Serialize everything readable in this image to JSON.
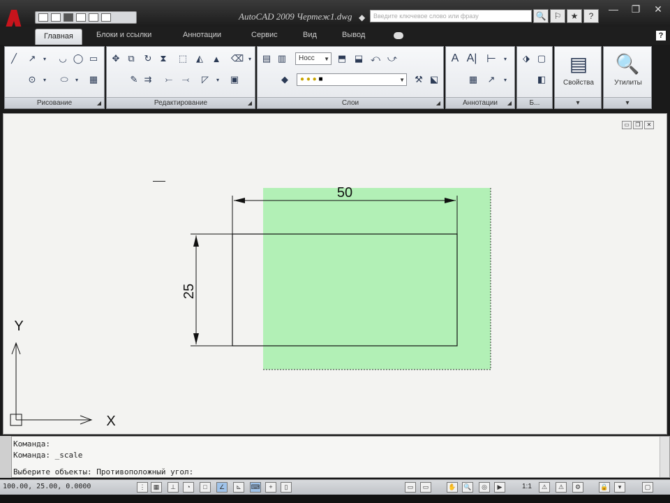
{
  "window": {
    "title": "AutoCAD 2009 Чертеж1.dwg",
    "search_placeholder": "Введите ключевое слово или фразу",
    "controls": [
      "—",
      "❐",
      "✕"
    ],
    "help_label": "?"
  },
  "ribbon_tabs": [
    {
      "label": "Главная",
      "active": true
    },
    {
      "label": "Блоки и ссылки",
      "active": false
    },
    {
      "label": "Аннотации",
      "active": false
    },
    {
      "label": "Сервис",
      "active": false
    },
    {
      "label": "Вид",
      "active": false
    },
    {
      "label": "Вывод",
      "active": false
    }
  ],
  "panels": {
    "draw": {
      "title": "Рисование"
    },
    "modify": {
      "title": "Редактирование"
    },
    "layers": {
      "title": "Слои",
      "layer_combo": "Носс"
    },
    "annotation": {
      "title": "Аннотации"
    },
    "blocks": {
      "title": "Б..."
    },
    "properties": {
      "label": "Свойства"
    },
    "utilities": {
      "label": "Утилиты"
    }
  },
  "drawing": {
    "dim_horizontal": "50",
    "dim_vertical": "25",
    "axis_x": "X",
    "axis_y": "Y",
    "colors": {
      "background": "#f3f3f1",
      "selection_fill": "#b2f0b6",
      "line": "#111111"
    }
  },
  "command_line": {
    "lines": [
      "Команда:",
      "Команда:  _scale",
      "Выберите объекты: Противоположный угол:"
    ]
  },
  "statusbar": {
    "coords": "100.00, 25.00, 0.0000",
    "scale": "1:1"
  },
  "icons": {
    "line": "line-icon",
    "polyline": "polyline-icon",
    "circle": "circle-icon",
    "arc": "arc-icon",
    "rectangle": "rectangle-icon",
    "move": "move-icon",
    "copy": "copy-icon",
    "rotate": "rotate-icon",
    "text": "text-icon",
    "dimension": "dimension-icon",
    "properties": "properties-icon",
    "zoom": "zoom-icon"
  }
}
